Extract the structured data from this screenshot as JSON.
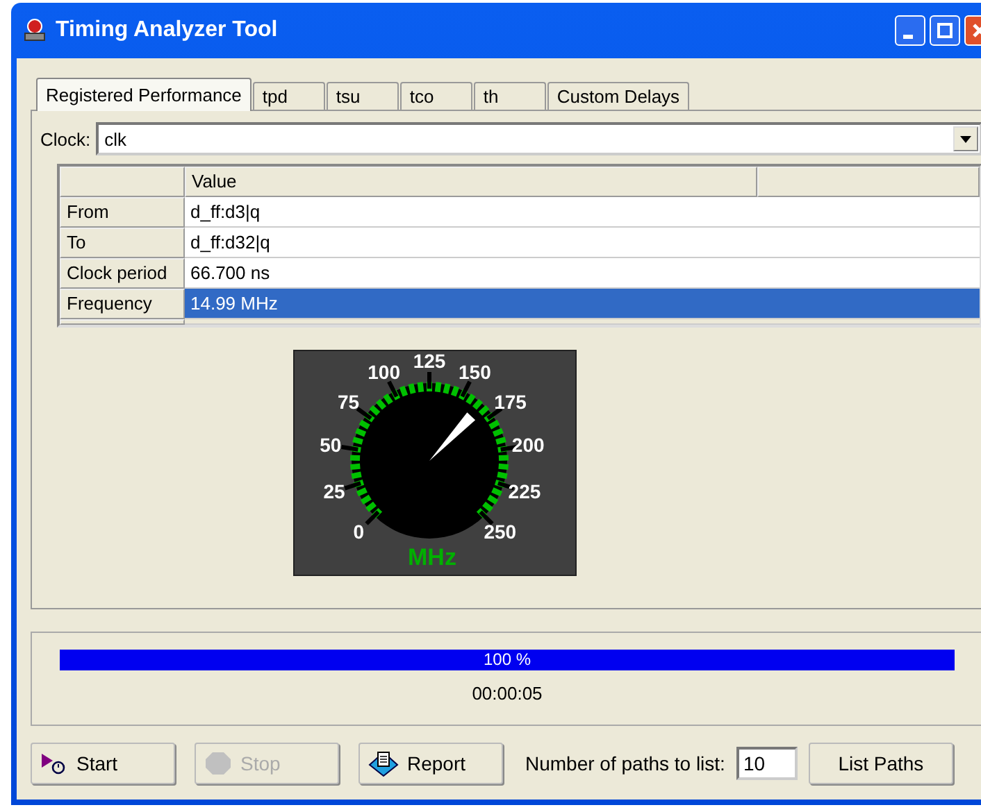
{
  "window": {
    "title": "Timing Analyzer Tool"
  },
  "tabs": [
    {
      "label": "Registered Performance",
      "selected": true
    },
    {
      "label": "tpd",
      "selected": false
    },
    {
      "label": "tsu",
      "selected": false
    },
    {
      "label": "tco",
      "selected": false
    },
    {
      "label": "th",
      "selected": false
    },
    {
      "label": "Custom Delays",
      "selected": false
    }
  ],
  "clock": {
    "label": "Clock:",
    "value": "clk"
  },
  "table": {
    "columns": [
      "Value"
    ],
    "rows": [
      {
        "label": "From",
        "value": "d_ff:d3|q",
        "selected": false
      },
      {
        "label": "To",
        "value": "d_ff:d32|q",
        "selected": false
      },
      {
        "label": "Clock period",
        "value": "66.700 ns",
        "selected": false
      },
      {
        "label": "Frequency",
        "value": "14.99 MHz",
        "selected": true
      }
    ]
  },
  "gauge": {
    "labels": [
      "0",
      "25",
      "50",
      "75",
      "100",
      "125",
      "150",
      "175",
      "200",
      "225",
      "250"
    ],
    "unit": "MHz",
    "level": 0.66
  },
  "progress": {
    "level": 1,
    "reading": "100 %",
    "elapsed": "00:00:05"
  },
  "buttons": [
    {
      "label": "Start",
      "kind": "start",
      "disabled": false
    },
    {
      "label": "Stop",
      "kind": "stop",
      "disabled": true
    },
    {
      "label": "Report",
      "kind": "report",
      "disabled": false
    }
  ],
  "paths": {
    "label": "Number of paths to list:",
    "value": "10",
    "button": "List Paths"
  }
}
